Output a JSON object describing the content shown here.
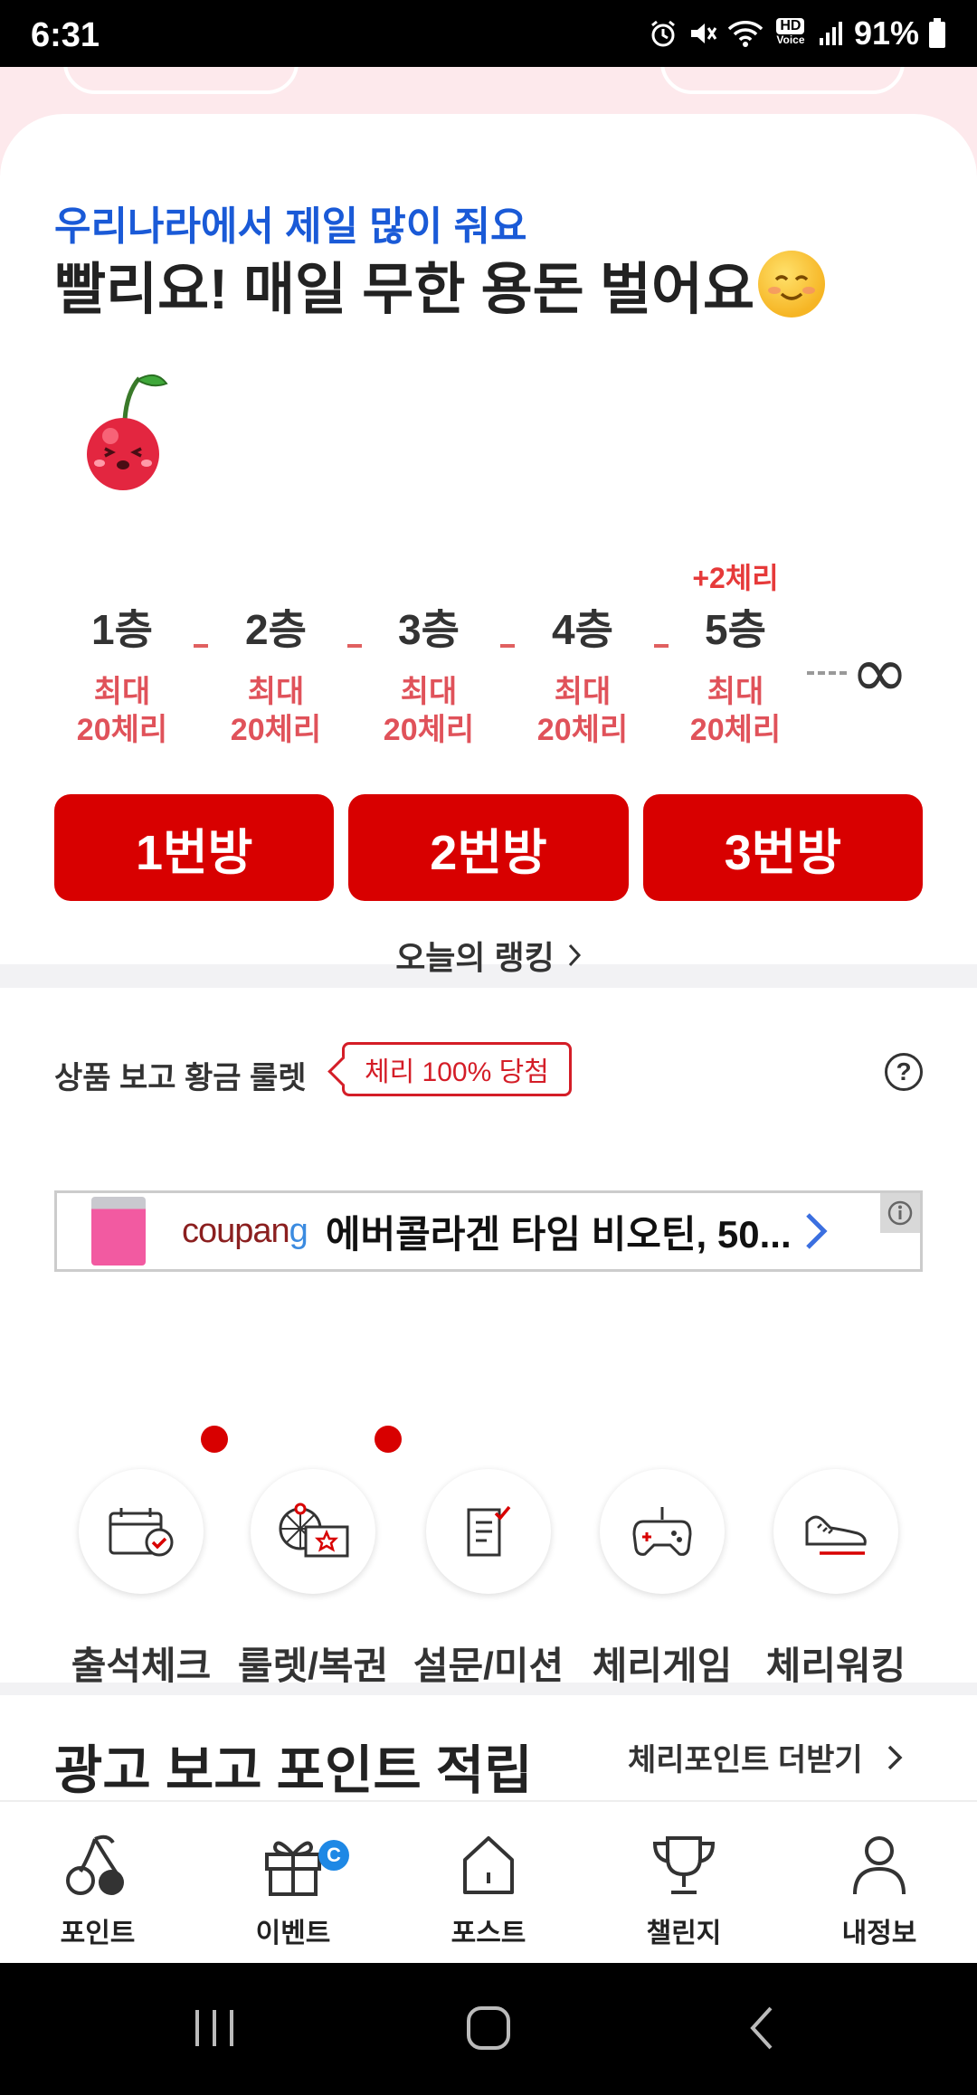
{
  "status_bar": {
    "time": "6:31",
    "battery": "91%",
    "hd_label": "HD",
    "voice_label": "Voice"
  },
  "hero": {
    "subtitle": "우리나라에서 제일 많이 줘요",
    "title": "빨리요! 매일 무한 용돈 벌어요"
  },
  "floors": [
    {
      "name": "1층",
      "max_line1": "최대",
      "max_line2": "20체리",
      "bonus": ""
    },
    {
      "name": "2층",
      "max_line1": "최대",
      "max_line2": "20체리",
      "bonus": ""
    },
    {
      "name": "3층",
      "max_line1": "최대",
      "max_line2": "20체리",
      "bonus": ""
    },
    {
      "name": "4층",
      "max_line1": "최대",
      "max_line2": "20체리",
      "bonus": ""
    },
    {
      "name": "5층",
      "max_line1": "최대",
      "max_line2": "20체리",
      "bonus": "+2체리"
    }
  ],
  "infinity_symbol": "∞",
  "rooms": [
    {
      "label": "1번방"
    },
    {
      "label": "2번방"
    },
    {
      "label": "3번방"
    }
  ],
  "ranking_link": "오늘의 랭킹",
  "roulette": {
    "title": "상품 보고 황금 룰렛",
    "tooltip": "체리 100% 당첨",
    "help_symbol": "?",
    "ad": {
      "brand": "coupan",
      "brand_g": "g",
      "text": "에버콜라겐 타임 비오틴, 50..."
    }
  },
  "menu": [
    {
      "label": "출석체크",
      "icon": "calendar-check-icon",
      "has_dot": false
    },
    {
      "label": "룰렛/복권",
      "icon": "roulette-ticket-icon",
      "has_dot": true
    },
    {
      "label": "설문/미션",
      "icon": "survey-clipboard-icon",
      "has_dot": true
    },
    {
      "label": "체리게임",
      "icon": "gamepad-icon",
      "has_dot": false
    },
    {
      "label": "체리워킹",
      "icon": "sneaker-icon",
      "has_dot": false
    }
  ],
  "ads_section": {
    "title": "광고 보고 포인트 적립",
    "more_link": "체리포인트 더받기"
  },
  "bottom_nav": [
    {
      "label": "포인트",
      "icon": "cherry-icon"
    },
    {
      "label": "이벤트",
      "icon": "gift-icon",
      "badge": "C"
    },
    {
      "label": "포스트",
      "icon": "home-icon"
    },
    {
      "label": "챌린지",
      "icon": "trophy-icon"
    },
    {
      "label": "내정보",
      "icon": "person-icon"
    }
  ],
  "colors": {
    "accent_red": "#d80000",
    "subtitle_blue": "#1a5ad7",
    "pink_bg": "#fde9ec",
    "badge_blue": "#1e88e5"
  }
}
